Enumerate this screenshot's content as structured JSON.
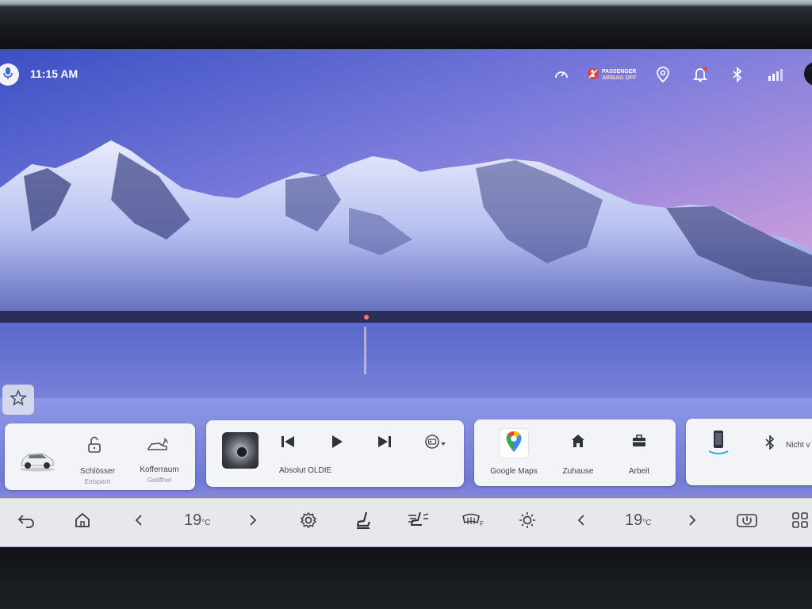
{
  "status_bar": {
    "time": "11:15 AM",
    "airbag_line1": "PASSENGER",
    "airbag_line2": "AIRBAG OFF"
  },
  "vehicle": {
    "locks_label": "Schlösser",
    "locks_status": "Entsperrt",
    "trunk_label": "Kofferraum",
    "trunk_status": "Geöffnet"
  },
  "media": {
    "station": "Absolut OLDIE"
  },
  "navigation": {
    "items": [
      {
        "label": "Google Maps"
      },
      {
        "label": "Zuhause"
      },
      {
        "label": "Arbeit"
      }
    ]
  },
  "phone": {
    "status": "Nicht v"
  },
  "climate": {
    "left_temp": "19",
    "right_temp": "19",
    "unit": "°C"
  },
  "colors": {
    "sky_top": "#3f57c7",
    "sky_pink": "#c49be0",
    "card_bg": "#f3f4f7",
    "dock_bg": "#e7e8ec",
    "icon_dark": "#2f333a"
  }
}
